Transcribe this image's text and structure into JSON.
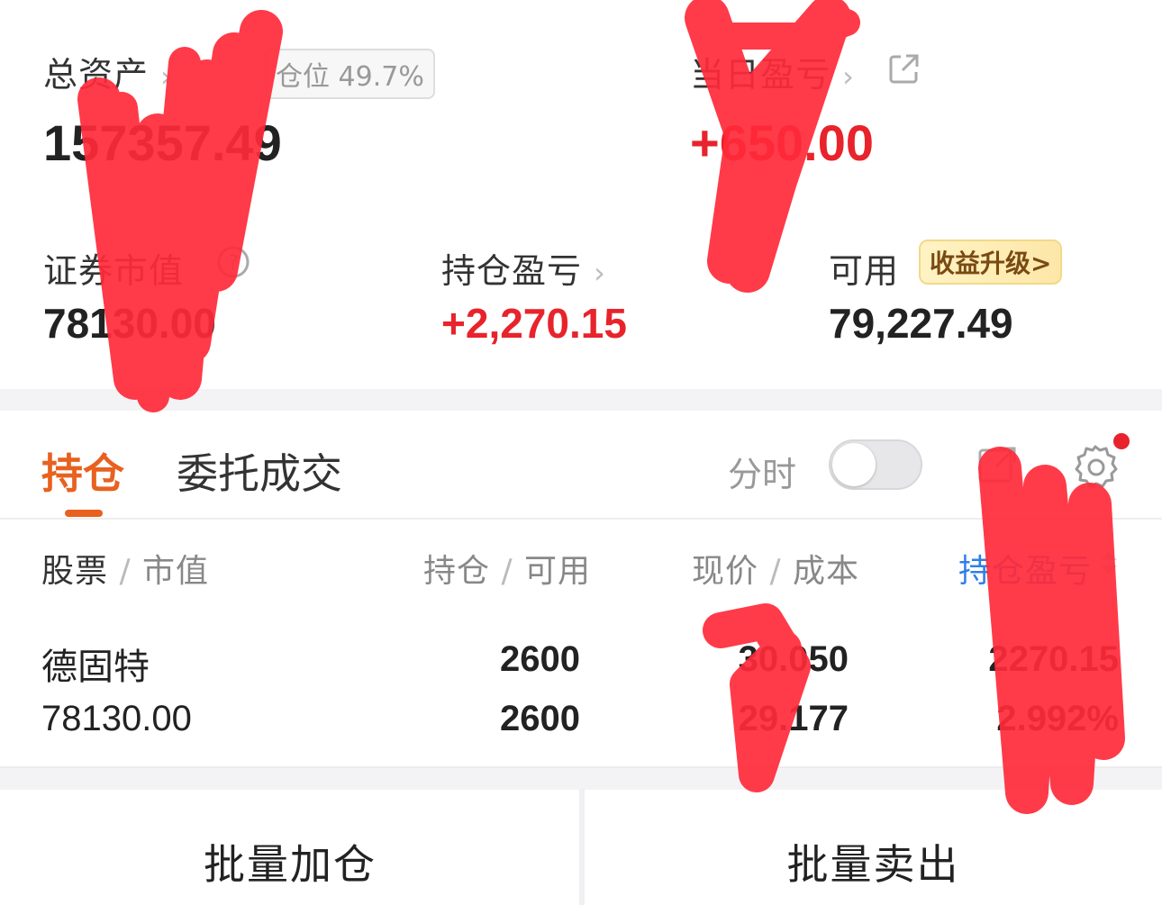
{
  "summary": {
    "total_assets_label": "总资产",
    "position_badge": "仓位 49.7%",
    "total_assets_value": "157357.49",
    "daily_pnl_label": "当日盈亏",
    "daily_pnl_value": "+650.00",
    "market_value_label": "证券市值",
    "market_value_value": "78130.00",
    "holding_pnl_label": "持仓盈亏",
    "holding_pnl_value": "+2,270.15",
    "available_label": "可用",
    "upgrade_badge": "收益升级>",
    "available_value": "79,227.49"
  },
  "tabs": {
    "positions": "持仓",
    "orders": "委托成交",
    "timeshare_label": "分时",
    "timeshare_on": false
  },
  "table": {
    "col_stock": "股票",
    "col_stock_sub": "市值",
    "col_holding": "持仓",
    "col_holding_sub": "可用",
    "col_price": "现价",
    "col_price_sub": "成本",
    "col_pnl": "持仓盈亏",
    "rows": [
      {
        "name": "德固特",
        "market_value": "78130.00",
        "holding": "2600",
        "available": "2600",
        "price": "30.050",
        "cost": "29.177",
        "pnl": "2270.15",
        "pnl_pct": "2.992%"
      }
    ]
  },
  "actions": {
    "batch_add": "批量加仓",
    "batch_sell": "批量卖出"
  },
  "colors": {
    "accent": "#e8611f",
    "gain": "#e8232b",
    "link": "#2f7fe8"
  }
}
